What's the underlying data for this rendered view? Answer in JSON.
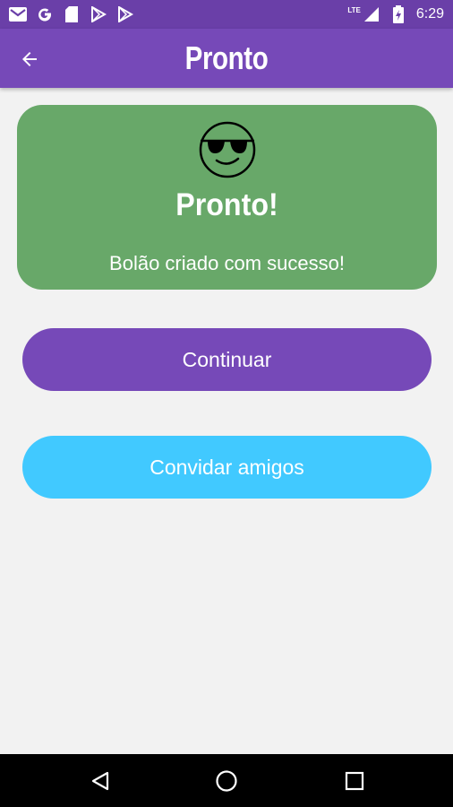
{
  "status_bar": {
    "time": "6:29",
    "network": "LTE",
    "icons": [
      "gmail-icon",
      "google-icon",
      "sd-card-icon",
      "play-store-icon",
      "play-store-icon",
      "signal-icon",
      "battery-icon"
    ]
  },
  "app_bar": {
    "title": "Pronto",
    "back_icon": "arrow-back-icon",
    "color": "#7649b8"
  },
  "card": {
    "icon": "sunglasses-smiley-icon",
    "title": "Pronto!",
    "subtitle": "Bolão criado com sucesso!",
    "color": "#68a869"
  },
  "buttons": {
    "continue_label": "Continuar",
    "continue_color": "#7649b8",
    "invite_label": "Convidar amigos",
    "invite_color": "#41c9ff"
  },
  "nav_bar": {
    "icons": [
      "nav-back-icon",
      "nav-home-icon",
      "nav-recents-icon"
    ]
  }
}
